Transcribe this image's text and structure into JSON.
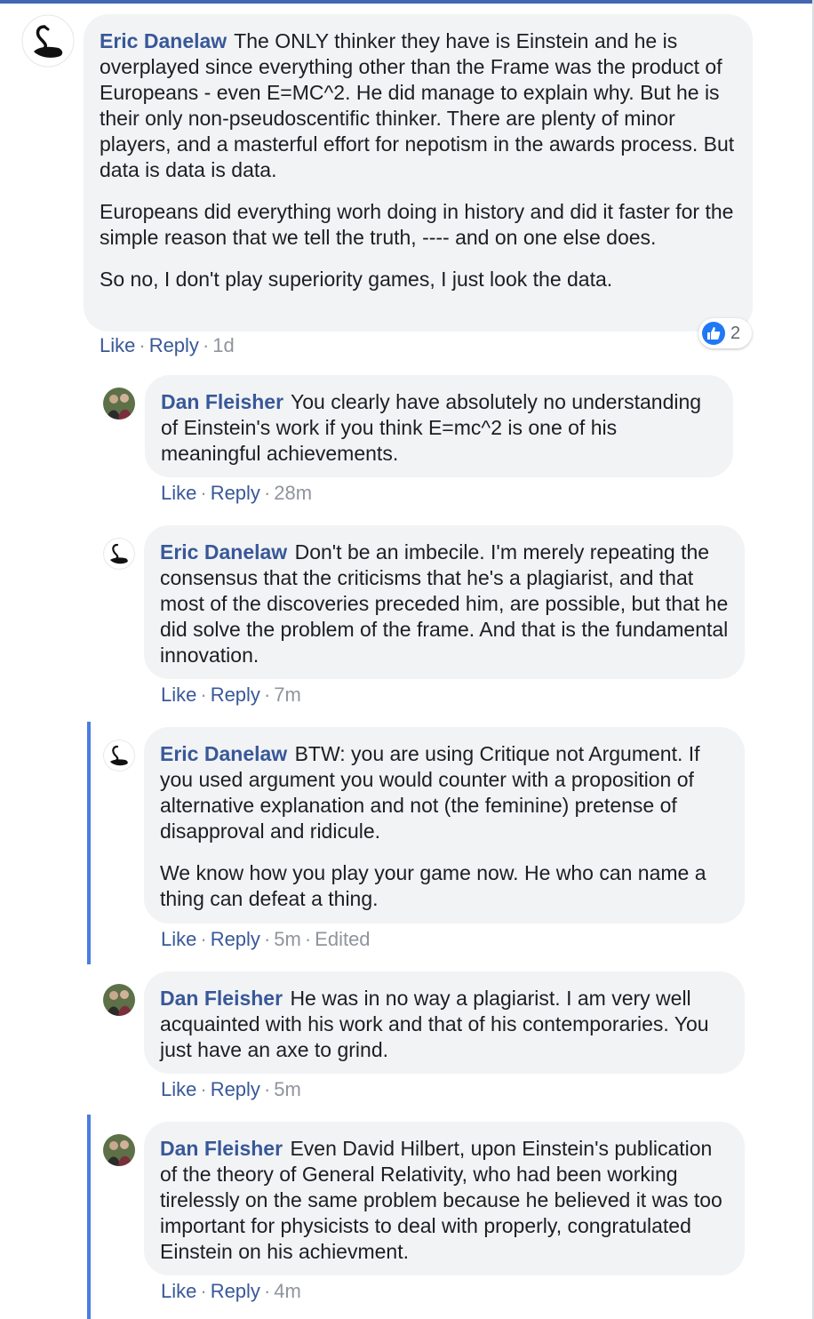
{
  "comments": [
    {
      "author": "Eric Danelaw",
      "paragraphs": [
        "The ONLY thinker they have is Einstein and he is overplayed since everything other than the Frame was the product of Europeans - even E=MC^2. He did manage to explain why. But he is their only non-pseudoscentific thinker. There are plenty of minor players, and a masterful effort for nepotism in the awards process. But data is data is data.",
        "Europeans did everything worh doing in history and did it faster for the simple reason that we tell the truth, ---- and on one else does.",
        "So no, I don't play superiority games, I just look the data."
      ],
      "like": "Like",
      "reply": "Reply",
      "time": "1d",
      "reaction_count": "2",
      "avatar_icon": "black-swan-icon"
    },
    {
      "author": "Dan Fleisher",
      "paragraphs": [
        "You clearly have absolutely no understanding of Einstein's work if you think E=mc^2 is one of his meaningful achievements."
      ],
      "like": "Like",
      "reply": "Reply",
      "time": "28m",
      "avatar_icon": "profile-photo"
    },
    {
      "author": "Eric Danelaw",
      "paragraphs": [
        "Don't be an imbecile. I'm merely repeating the consensus that the criticisms that he's a plagiarist, and that most of the discoveries preceded him, are possible, but that he did solve the problem of the frame. And that is the fundamental innovation."
      ],
      "like": "Like",
      "reply": "Reply",
      "time": "7m",
      "avatar_icon": "black-swan-icon"
    },
    {
      "author": "Eric Danelaw",
      "paragraphs": [
        "BTW: you are using Critique not Argument. If you used argument you would counter with a proposition of alternative explanation and not (the feminine) pretense of disapproval and ridicule.",
        "We know how you play your game now. He who can name a thing can defeat a thing."
      ],
      "like": "Like",
      "reply": "Reply",
      "time": "5m",
      "edited": "Edited",
      "avatar_icon": "black-swan-icon"
    },
    {
      "author": "Dan Fleisher",
      "paragraphs": [
        "He was in no way a plagiarist. I am very well acquainted with his work and that of his contemporaries. You just have an axe to grind."
      ],
      "like": "Like",
      "reply": "Reply",
      "time": "5m",
      "avatar_icon": "profile-photo"
    },
    {
      "author": "Dan Fleisher",
      "paragraphs": [
        "Even David Hilbert, upon Einstein's publication of the theory of General Relativity, who had been working tirelessly on the same problem because he believed it was too important for physicists to deal with properly, congratulated Einstein on his achievment."
      ],
      "like": "Like",
      "reply": "Reply",
      "time": "4m",
      "avatar_icon": "profile-photo"
    }
  ],
  "separator": "·",
  "colors": {
    "link": "#385898",
    "bubble": "#f2f3f5",
    "meta": "#90949c",
    "thread_line": "#4c7ce0",
    "like_blue": "#2078f4"
  }
}
